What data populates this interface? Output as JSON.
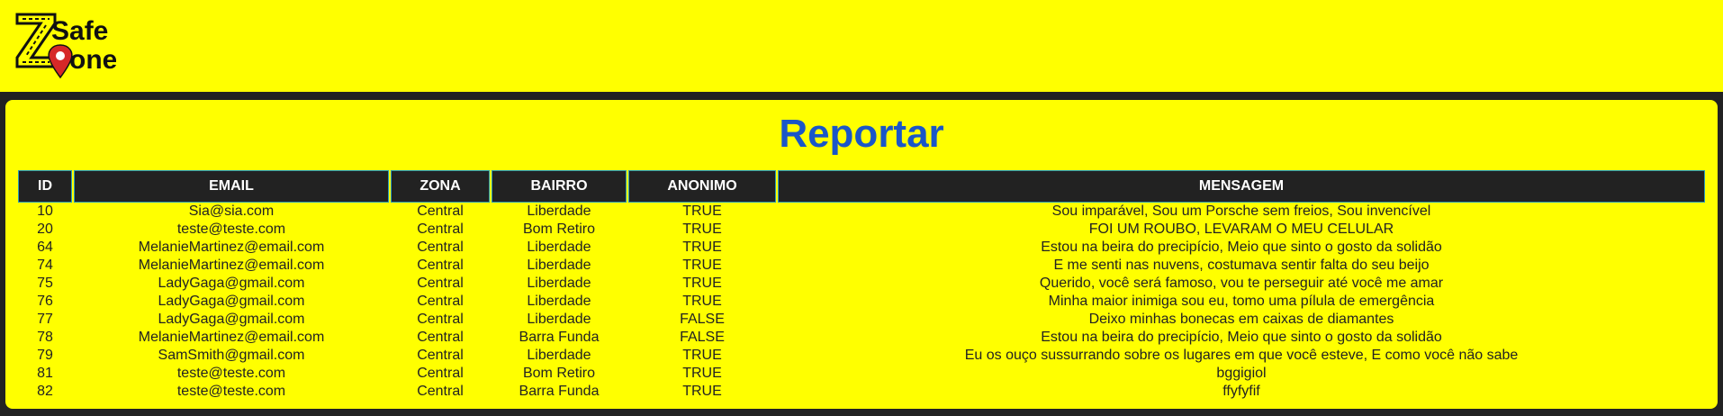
{
  "logo": {
    "text_top": "Safe",
    "text_bottom": "one",
    "letter": "Z"
  },
  "page": {
    "title": "Reportar"
  },
  "table": {
    "headers": [
      "ID",
      "EMAIL",
      "ZONA",
      "BAIRRO",
      "ANONIMO",
      "MENSAGEM"
    ],
    "rows": [
      [
        "10",
        "Sia@sia.com",
        "Central",
        "Liberdade",
        "TRUE",
        "Sou imparável, Sou um Porsche sem freios, Sou invencível"
      ],
      [
        "20",
        "teste@teste.com",
        "Central",
        "Bom Retiro",
        "TRUE",
        "FOI UM ROUBO, LEVARAM O MEU CELULAR"
      ],
      [
        "64",
        "MelanieMartinez@email.com",
        "Central",
        "Liberdade",
        "TRUE",
        "Estou na beira do precipício, Meio que sinto o gosto da solidão"
      ],
      [
        "74",
        "MelanieMartinez@email.com",
        "Central",
        "Liberdade",
        "TRUE",
        "E me senti nas nuvens, costumava sentir falta do seu beijo"
      ],
      [
        "75",
        "LadyGaga@gmail.com",
        "Central",
        "Liberdade",
        "TRUE",
        "Querido, você será famoso, vou te perseguir até você me amar"
      ],
      [
        "76",
        "LadyGaga@gmail.com",
        "Central",
        "Liberdade",
        "TRUE",
        "Minha maior inimiga sou eu, tomo uma pílula de emergência"
      ],
      [
        "77",
        "LadyGaga@gmail.com",
        "Central",
        "Liberdade",
        "FALSE",
        "Deixo minhas bonecas em caixas de diamantes"
      ],
      [
        "78",
        "MelanieMartinez@email.com",
        "Central",
        "Barra Funda",
        "FALSE",
        "Estou na beira do precipício, Meio que sinto o gosto da solidão"
      ],
      [
        "79",
        "SamSmith@gmail.com",
        "Central",
        "Liberdade",
        "TRUE",
        "Eu os ouço sussurrando sobre os lugares em que você esteve, E como você não sabe"
      ],
      [
        "81",
        "teste@teste.com",
        "Central",
        "Bom Retiro",
        "TRUE",
        "bggigiol"
      ],
      [
        "82",
        "teste@teste.com",
        "Central",
        "Barra Funda",
        "TRUE",
        "ffyfyfif"
      ]
    ]
  },
  "colors": {
    "background": "#ffff00",
    "frame": "#222222",
    "title": "#1a56c8",
    "header_border": "#2a9bb8",
    "logo_pin": "#d62828"
  }
}
